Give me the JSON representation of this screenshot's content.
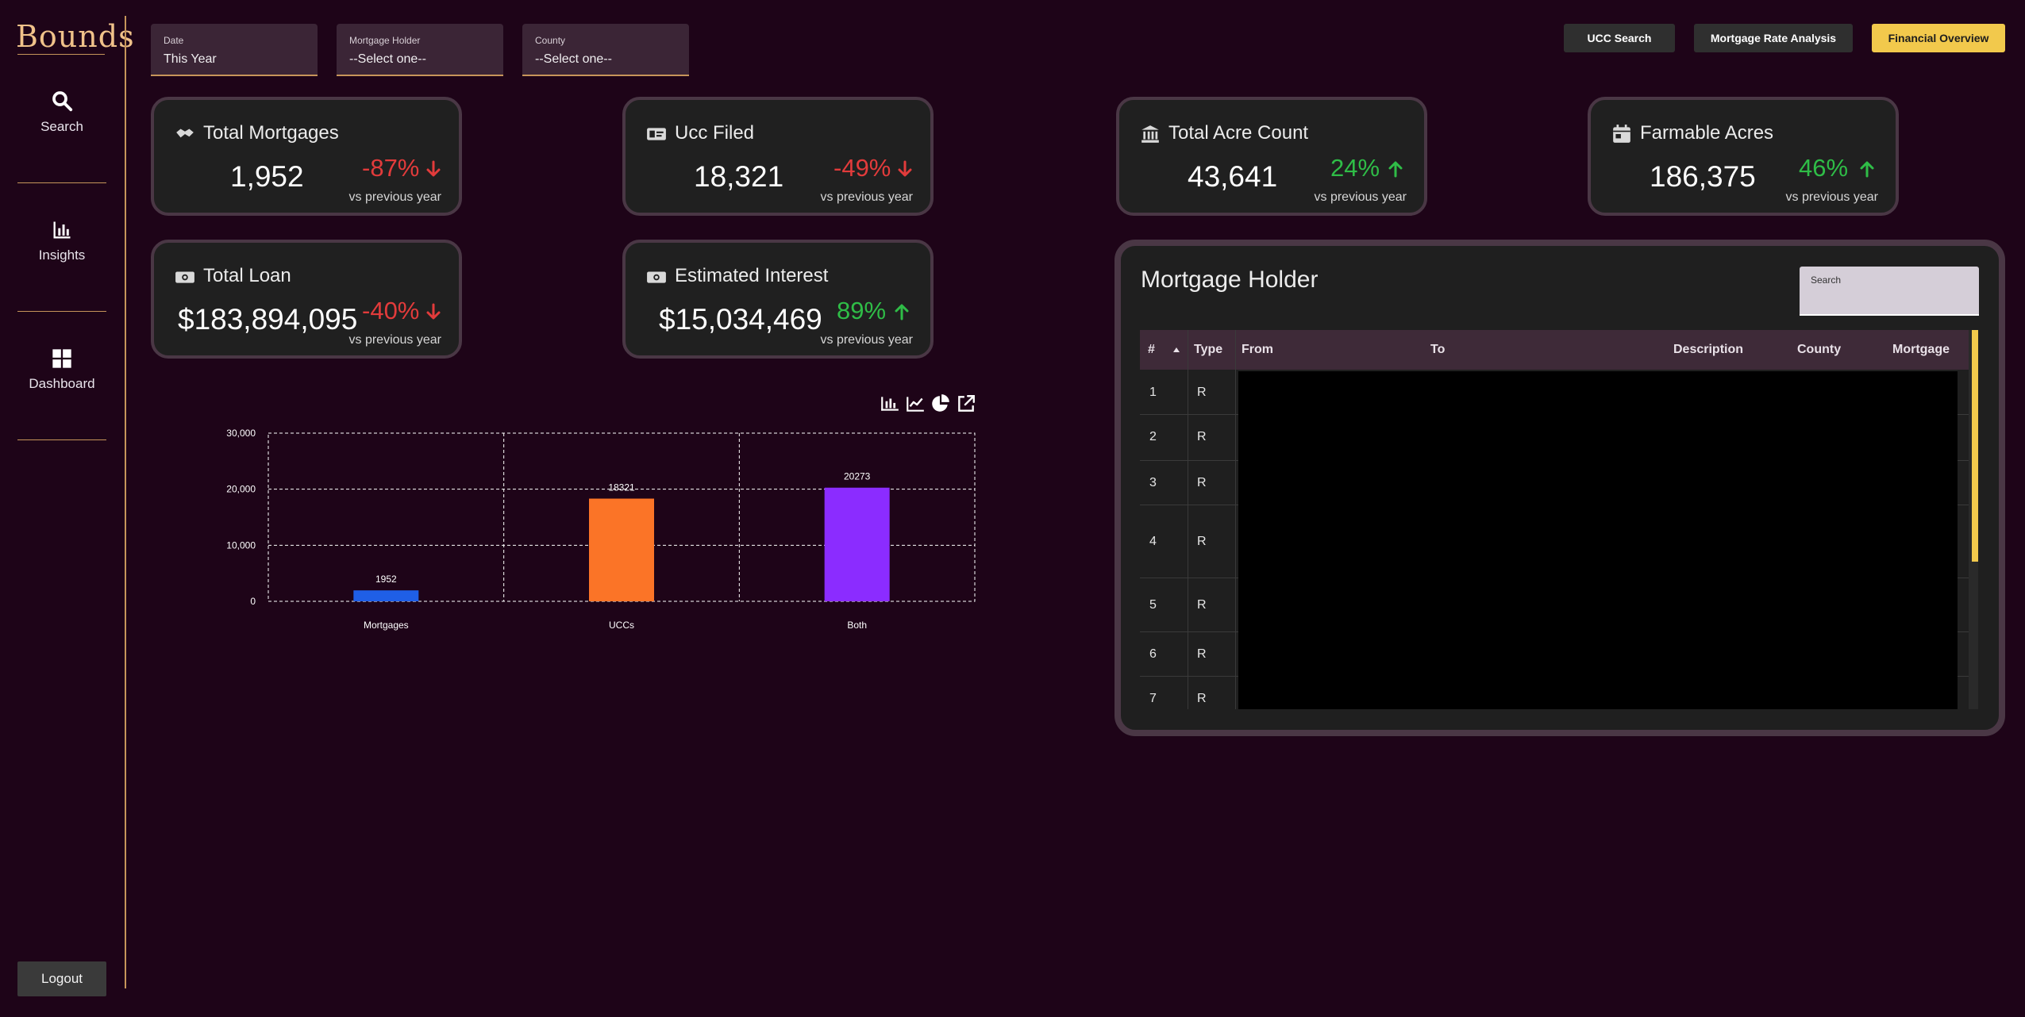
{
  "app": {
    "logo_text": "Bounds"
  },
  "sidebar": {
    "items": [
      {
        "label": "Search",
        "icon": "search-icon"
      },
      {
        "label": "Insights",
        "icon": "bar-chart-icon"
      },
      {
        "label": "Dashboard",
        "icon": "grid-icon"
      }
    ],
    "logout_label": "Logout"
  },
  "filters": [
    {
      "label": "Date",
      "value": "This Year"
    },
    {
      "label": "Mortgage Holder",
      "value": "--Select one--"
    },
    {
      "label": "County",
      "value": "--Select one--"
    }
  ],
  "top_buttons": {
    "ucc_search": "UCC Search",
    "mortgage_rate": "Mortgage Rate Analysis",
    "financial_overview": "Financial Overview"
  },
  "kpis": {
    "total_mortgages": {
      "title": "Total Mortgages",
      "value": "1,952",
      "change": "-87%",
      "direction": "down",
      "sub": "vs previous year",
      "icon": "handshake-icon"
    },
    "ucc_filed": {
      "title": "Ucc Filed",
      "value": "18,321",
      "change": "-49%",
      "direction": "down",
      "sub": "vs previous year",
      "icon": "id-card-icon"
    },
    "total_acre_count": {
      "title": "Total Acre Count",
      "value": "43,641",
      "change": "24%",
      "direction": "up",
      "sub": "vs previous year",
      "icon": "bank-icon"
    },
    "farmable_acres": {
      "title": "Farmable Acres",
      "value": "186,375",
      "change": "46%",
      "direction": "up",
      "sub": "vs previous year",
      "icon": "calendar-icon"
    },
    "total_loan": {
      "title": "Total Loan",
      "value": "$183,894,095",
      "change": "-40%",
      "direction": "down",
      "sub": "vs previous year",
      "icon": "cash-icon"
    },
    "estimated_interest": {
      "title": "Estimated Interest",
      "value": "$15,034,469",
      "change": "89%",
      "direction": "up",
      "sub": "vs previous year",
      "icon": "cash-icon"
    }
  },
  "colors": {
    "negative": "#e23b3b",
    "positive": "#2fbd47",
    "accent": "#f2c94c",
    "card_border": "#4a3745"
  },
  "chart_toolbar": [
    "bar-chart-icon",
    "line-chart-icon",
    "pie-chart-icon",
    "external-link-icon"
  ],
  "chart_data": {
    "type": "bar",
    "categories": [
      "Mortgages",
      "UCCs",
      "Both"
    ],
    "values": [
      1952,
      18321,
      20273
    ],
    "colors": [
      "#1f5fe6",
      "#fb7427",
      "#8b2cff"
    ],
    "data_labels": [
      "1952",
      "18321",
      "20273"
    ],
    "ylim": [
      0,
      30000
    ],
    "yticks": [
      0,
      10000,
      20000,
      30000
    ],
    "ytick_labels": [
      "0",
      "10,000",
      "20,000",
      "30,000"
    ],
    "grid": true,
    "title": "",
    "xlabel": "",
    "ylabel": ""
  },
  "mortgage_holder": {
    "title": "Mortgage Holder",
    "search_label": "Search",
    "columns": [
      "#",
      "Type",
      "From",
      "To",
      "Description",
      "County",
      "Mortgage"
    ],
    "rows": [
      {
        "num": "1",
        "type": "R"
      },
      {
        "num": "2",
        "type": "R"
      },
      {
        "num": "3",
        "type": "R"
      },
      {
        "num": "4",
        "type": "R"
      },
      {
        "num": "5",
        "type": "R"
      },
      {
        "num": "6",
        "type": "R"
      },
      {
        "num": "7",
        "type": "R"
      }
    ]
  }
}
